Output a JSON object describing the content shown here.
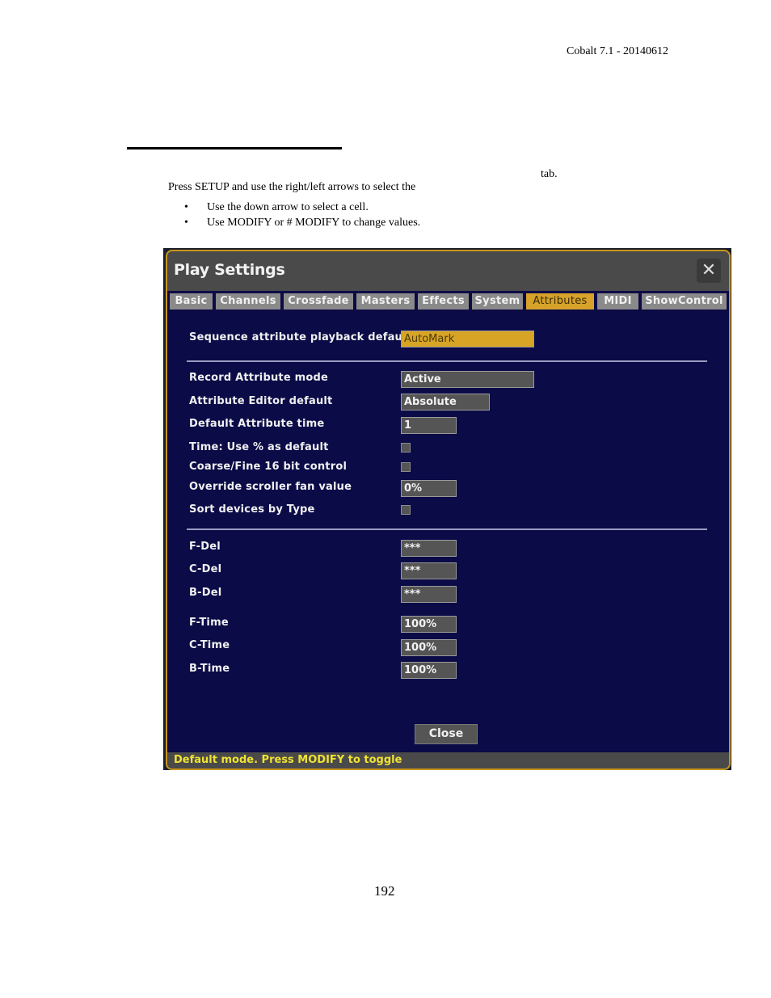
{
  "document": {
    "header_ref": "Cobalt 7.1 - 20140612",
    "intro_text": "Press SETUP and use the right/left arrows to select the",
    "intro_tail": "tab.",
    "bullets": [
      "Use the down arrow to select a cell.",
      "Use MODIFY or # MODIFY to change values."
    ],
    "page_number": "192"
  },
  "dialog": {
    "title": "Play Settings",
    "close_icon": "close-x-icon",
    "tabs": [
      {
        "label": "Basic",
        "active": false
      },
      {
        "label": "Channels",
        "active": false
      },
      {
        "label": "Crossfade",
        "active": false
      },
      {
        "label": "Masters",
        "active": false
      },
      {
        "label": "Effects",
        "active": false
      },
      {
        "label": "System",
        "active": false
      },
      {
        "label": "Attributes",
        "active": true
      },
      {
        "label": "MIDI",
        "active": false
      },
      {
        "label": "ShowControl",
        "active": false
      }
    ],
    "settings": {
      "sequence_attr_playback_default": {
        "label": "Sequence attribute playback default",
        "value": "AutoMark"
      },
      "record_attribute_mode": {
        "label": "Record Attribute mode",
        "value": "Active"
      },
      "attribute_editor_default": {
        "label": "Attribute Editor default",
        "value": "Absolute"
      },
      "default_attribute_time": {
        "label": "Default Attribute time",
        "value": "1"
      },
      "time_use_percent_default": {
        "label": "Time: Use % as default",
        "checked": false
      },
      "coarse_fine_16bit": {
        "label": "Coarse/Fine 16 bit control",
        "checked": false
      },
      "override_scroller_fan": {
        "label": "Override scroller fan value",
        "value": "0%"
      },
      "sort_devices_by_type": {
        "label": "Sort devices by Type",
        "checked": false
      },
      "f_del": {
        "label": "F-Del",
        "value": "***"
      },
      "c_del": {
        "label": "C-Del",
        "value": "***"
      },
      "b_del": {
        "label": "B-Del",
        "value": "***"
      },
      "f_time": {
        "label": "F-Time",
        "value": "100%"
      },
      "c_time": {
        "label": "C-Time",
        "value": "100%"
      },
      "b_time": {
        "label": "B-Time",
        "value": "100%"
      }
    },
    "close_button": "Close",
    "status_text": "Default mode. Press MODIFY to toggle",
    "colors": {
      "accent": "#d6a22a",
      "panel_bg": "#0b0b48",
      "status_text": "#f0e233"
    }
  }
}
